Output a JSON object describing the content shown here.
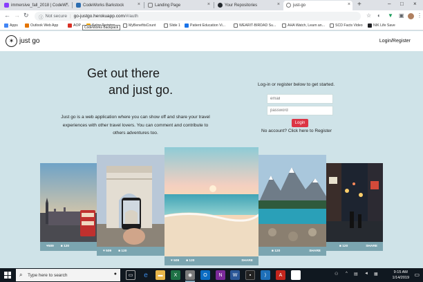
{
  "browser": {
    "tabs": [
      {
        "label": "immersive_fall_2018 | CodeW...",
        "color": "#8a3ffc"
      },
      {
        "label": "CodeWorks Barkstock",
        "color": "#2b6cb0"
      },
      {
        "label": "Landing Page",
        "color": "#5f6368"
      },
      {
        "label": "Your Repositories",
        "color": "#24292e"
      },
      {
        "label": "just-go",
        "color": "#5f6368"
      }
    ],
    "new_tab_icon": "+",
    "url_security": "Not secure",
    "url_host": "go-justgo.herokuapp.com",
    "url_path": "/#/auth",
    "tooltip": "CodeWorks Backpack",
    "bookmarks": [
      {
        "label": "Apps",
        "color": "#4285f4"
      },
      {
        "label": "Outlook Web App",
        "color": "#e37400"
      },
      {
        "label": "AOP",
        "color": "#d93025"
      },
      {
        "label": "Sales Training",
        "color": "#f9ab00"
      },
      {
        "label": "MyBenefitsCount",
        "color": "#666"
      },
      {
        "label": "Slide 1",
        "color": "#666"
      },
      {
        "label": "Patient Education Vi...",
        "color": "#1a73e8"
      },
      {
        "label": "WEARIT-BIRDAD Su...",
        "color": "#666"
      },
      {
        "label": "AHA Watch, Learn an...",
        "color": "#666"
      },
      {
        "label": "SCD Facts Video",
        "color": "#666"
      },
      {
        "label": "NIK Life Save",
        "color": "#202124"
      }
    ]
  },
  "site": {
    "logo_text": "just go",
    "nav_login": "Login/Register",
    "hero_line1": "Get out there",
    "hero_line2": "and just go.",
    "description": "Just go is a web application where you can show off and share your travel experiences with other travel lovers. You can comment and contribute to others adventures too.",
    "login_intro": "Log-in or register below to get started.",
    "email_placeholder": "email",
    "password_placeholder": "password",
    "login_button": "Login",
    "no_account": "No account? Click here to Register"
  },
  "cards": [
    {
      "likes": "♥509",
      "comments": "■ 120",
      "share": ""
    },
    {
      "likes": "♥ 509",
      "comments": "■ 120",
      "share": ""
    },
    {
      "likes": "♥ 509",
      "comments": "■ 120",
      "share": "SHARE"
    },
    {
      "likes": "",
      "comments": "■ 120",
      "share": "SHARE"
    },
    {
      "likes": "",
      "comments": "■ 120",
      "share": "SHARE"
    }
  ],
  "taskbar": {
    "search_placeholder": "Type here to search",
    "time": "9:15 AM",
    "date": "1/14/2019"
  }
}
